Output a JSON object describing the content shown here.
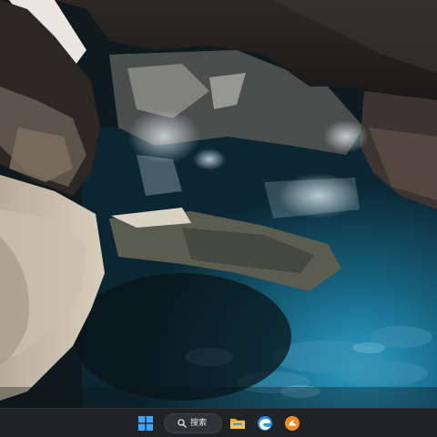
{
  "desktop": {
    "wallpaper": "cave-hot-spring-icon"
  },
  "taskbar": {
    "background": "#1f2326",
    "search": {
      "label": "搜索",
      "icon": "search-icon"
    },
    "buttons": [
      {
        "name": "start",
        "icon": "windows-logo-icon",
        "color": "#3ba4ff"
      },
      {
        "name": "file-explorer",
        "icon": "folder-icon",
        "color": "#f6c445"
      },
      {
        "name": "browser",
        "icon": "edge-browser-icon",
        "color": "#1f8ee8"
      },
      {
        "name": "app",
        "icon": "orange-app-icon",
        "color": "#f08a1c"
      }
    ]
  }
}
